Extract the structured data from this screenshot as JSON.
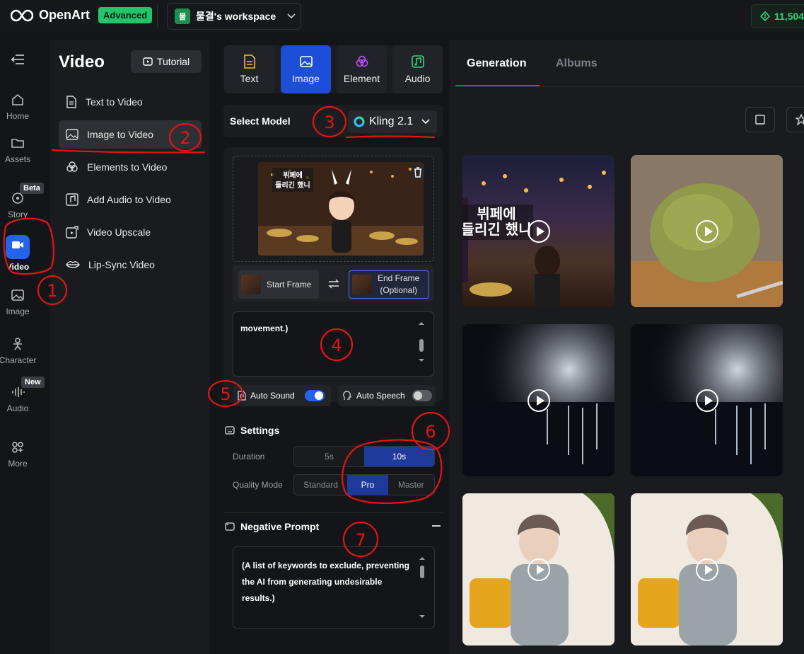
{
  "topbar": {
    "brand": "OpenArt",
    "plan_badge": "Advanced",
    "workspace_initial": "물",
    "workspace_name": "물결's workspace",
    "credits": "11,504"
  },
  "rail": {
    "items": [
      {
        "label": "Home"
      },
      {
        "label": "Assets"
      },
      {
        "label": "Story",
        "tag": "Beta"
      },
      {
        "label": "Video"
      },
      {
        "label": "Image"
      },
      {
        "label": "Character"
      },
      {
        "label": "Audio",
        "tag": "New"
      },
      {
        "label": "More"
      }
    ]
  },
  "subnav": {
    "title": "Video",
    "tutorial": "Tutorial",
    "items": [
      {
        "label": "Text to Video"
      },
      {
        "label": "Image to Video"
      },
      {
        "label": "Elements to Video"
      },
      {
        "label": "Add Audio to Video"
      },
      {
        "label": "Video Upscale"
      },
      {
        "label": "Lip-Sync Video"
      }
    ]
  },
  "input_tabs": [
    {
      "label": "Text"
    },
    {
      "label": "Image"
    },
    {
      "label": "Element"
    },
    {
      "label": "Audio"
    }
  ],
  "model": {
    "label": "Select Model",
    "value": "Kling 2.1"
  },
  "frames": {
    "start": "Start Frame",
    "end_line1": "End Frame",
    "end_line2": "(Optional)"
  },
  "thumb_text": {
    "line1": "뷔페에",
    "line2": "들리긴 했니"
  },
  "prompt": {
    "value": "movement.)"
  },
  "toggles": {
    "auto_sound": "Auto Sound",
    "auto_sound_on": true,
    "auto_speech": "Auto Speech",
    "auto_speech_on": false
  },
  "settings": {
    "title": "Settings",
    "duration_label": "Duration",
    "duration_options": [
      "5s",
      "10s"
    ],
    "duration_selected": "10s",
    "quality_label": "Quality Mode",
    "quality_options": [
      "Standard",
      "Pro",
      "Master"
    ],
    "quality_selected": "Pro"
  },
  "negative": {
    "title": "Negative Prompt",
    "placeholder": "(A list of keywords to exclude, preventing the AI from generating undesirable results.)"
  },
  "results": {
    "tabs": [
      "Generation",
      "Albums"
    ],
    "active_tab": "Generation"
  },
  "annotations": [
    "1",
    "2",
    "3",
    "4",
    "5",
    "6",
    "7"
  ],
  "colors": {
    "accent": "#2563eb",
    "brand_green": "#23c56b",
    "annotation_red": "#e01515"
  }
}
